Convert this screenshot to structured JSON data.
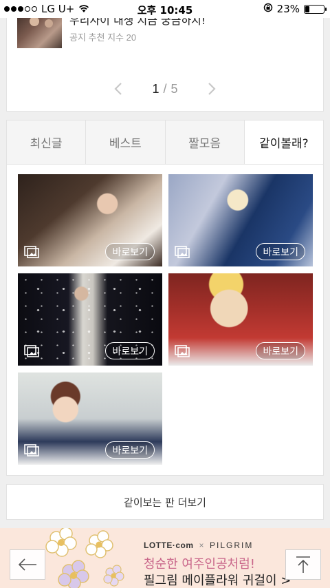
{
  "status_bar": {
    "carrier": "LG U+",
    "time": "오후 10:45",
    "battery_percent": "23%",
    "battery_level": 0.23
  },
  "article": {
    "title": "우리사이 내생 지금 궁금하지!",
    "meta": "공지 추천 지수 20"
  },
  "pagination": {
    "current": "1",
    "separator": "/",
    "total": "5"
  },
  "tabs": [
    {
      "label": "최신글",
      "active": false
    },
    {
      "label": "베스트",
      "active": false
    },
    {
      "label": "짤모음",
      "active": false
    },
    {
      "label": "같이볼래?",
      "active": true
    }
  ],
  "tiles": [
    {
      "view_label": "바로보기",
      "icon": "gallery-icon"
    },
    {
      "view_label": "바로보기",
      "icon": "gallery-icon"
    },
    {
      "view_label": "바로보기",
      "icon": "gallery-icon"
    },
    {
      "view_label": "바로보기",
      "icon": "gallery-icon"
    },
    {
      "view_label": "바로보기",
      "icon": "gallery-icon"
    }
  ],
  "more_button": "같이보는 판 더보기",
  "ad": {
    "brand_left": "LOTTE·com",
    "brand_x": "×",
    "brand_right": "PILGRIM",
    "line1": "청순한 여주인공처럼!",
    "line2": "필그림 메이플라워 귀걸이 >"
  },
  "colors": {
    "ad_background": "#fbe7dc",
    "ad_accent": "#c9668a",
    "page_background": "#efefef"
  }
}
